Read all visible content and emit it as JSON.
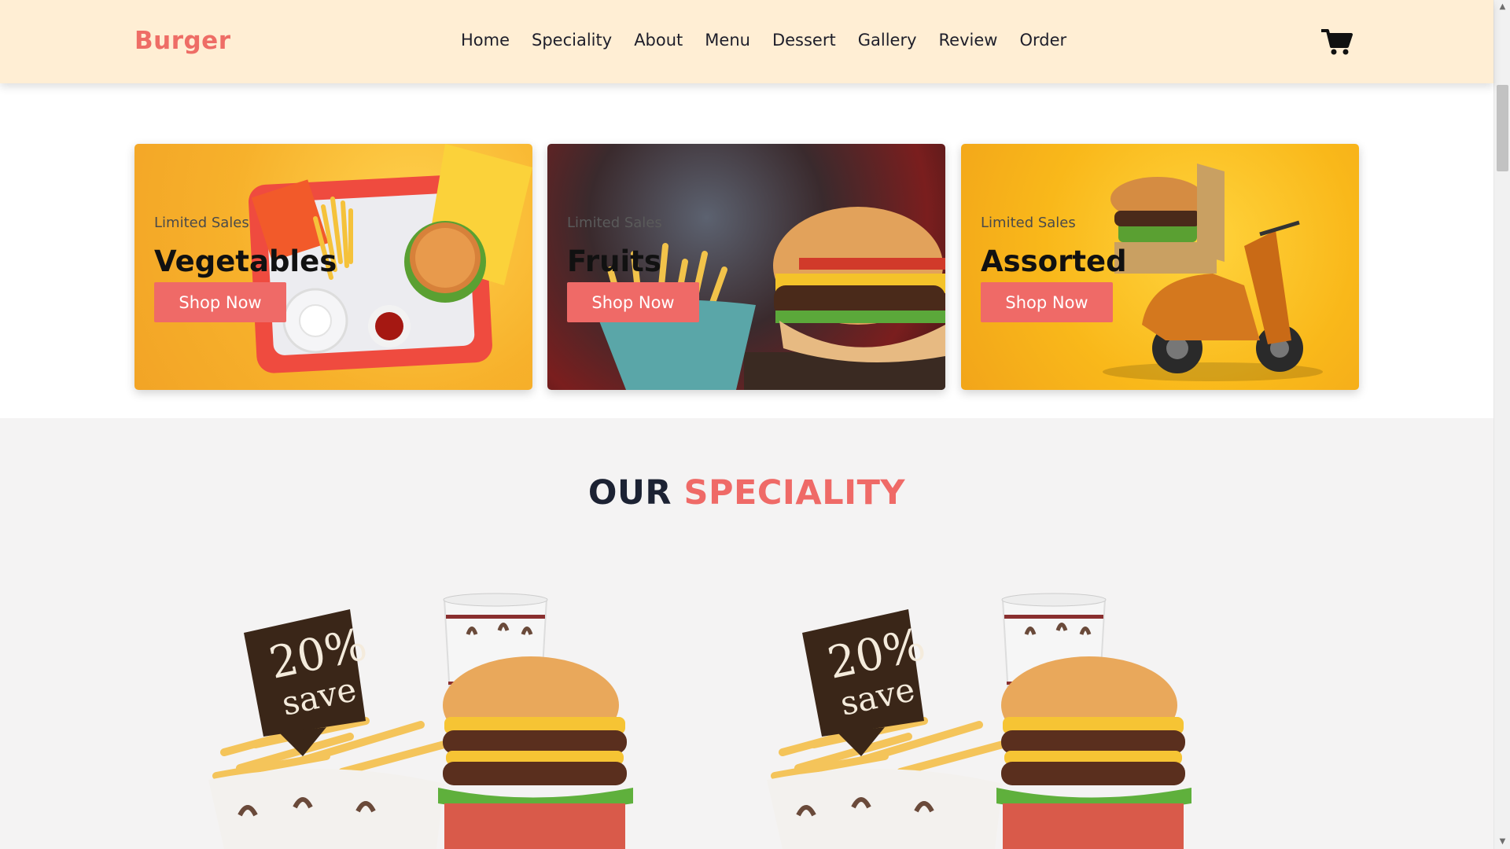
{
  "header": {
    "logo": "Burger",
    "nav": [
      "Home",
      "Speciality",
      "About",
      "Menu",
      "Dessert",
      "Gallery",
      "Review",
      "Order"
    ],
    "cart_icon": "cart-icon"
  },
  "banners": [
    {
      "subtitle": "Limited Sales",
      "title": "Vegetables",
      "button": "Shop Now"
    },
    {
      "subtitle": "Limited Sales",
      "title": "Fruits",
      "button": "Shop Now"
    },
    {
      "subtitle": "Limited Sales",
      "title": "Assorted",
      "button": "Shop Now"
    }
  ],
  "speciality": {
    "title_word1": "OUR",
    "title_word2": "SPECIALITY",
    "badge_percent": "20%",
    "badge_text": "save"
  },
  "colors": {
    "accent": "#ef6a67",
    "header_bg": "#ffeed4",
    "dark_text": "#1c2233"
  }
}
